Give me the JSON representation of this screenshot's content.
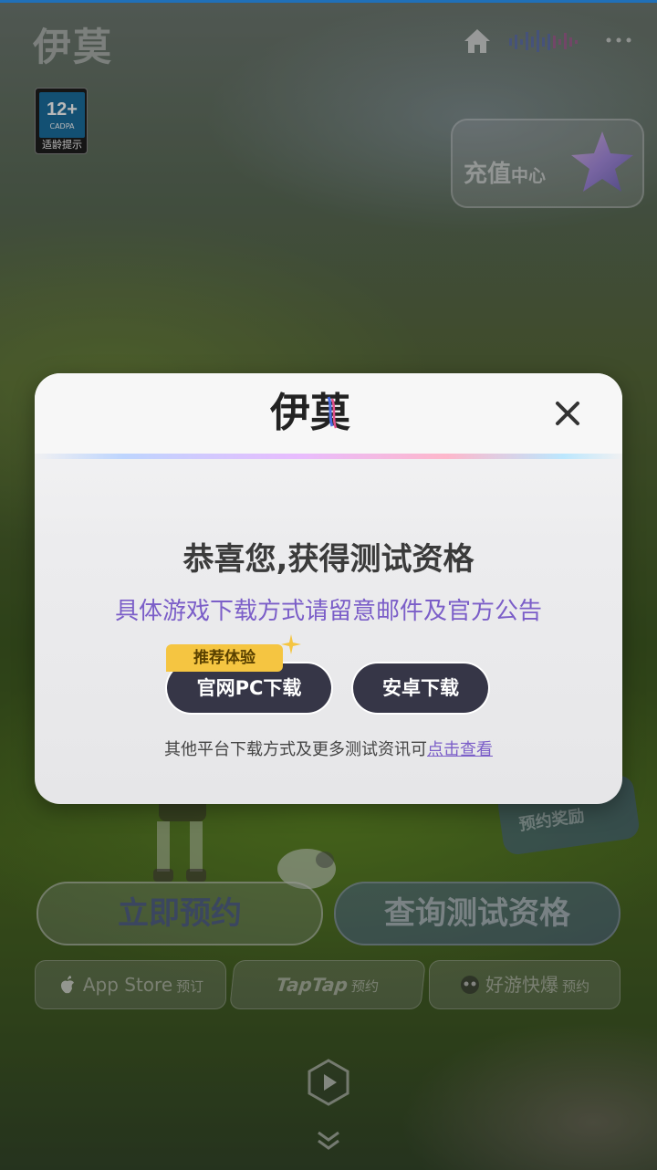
{
  "app": {
    "logo_text": "伊莫"
  },
  "header": {
    "icons": [
      "home-icon",
      "audio-wave-icon",
      "more-icon"
    ]
  },
  "age_rating": {
    "rating": "12+",
    "org": "CADPA",
    "hint": "适龄提示"
  },
  "recharge": {
    "label": "充值",
    "sub": "中心"
  },
  "modal": {
    "logo_text": "伊莫",
    "title": "恭喜您,获得测试资格",
    "subtitle": "具体游戏下载方式请留意邮件及官方公告",
    "recommend_badge": "推荐体验",
    "pc_download_label": "官网PC下载",
    "android_download_label": "安卓下载",
    "footer_text": "其他平台下载方式及更多测试资讯可",
    "footer_link": "点击查看"
  },
  "background_ui": {
    "reward_tag": "预约奖励",
    "reserve_label": "立即预约",
    "query_label": "查询测试资格",
    "stores": [
      {
        "name": "App Store",
        "action": "预订"
      },
      {
        "name": "TapTap",
        "action": "预约"
      },
      {
        "name": "好游快爆",
        "action": "预约"
      }
    ]
  },
  "colors": {
    "top_strip": "#2d9bff",
    "modal_bg": "#ececee",
    "button_dark": "#363647",
    "accent_purple": "#7b5ec8",
    "badge_yellow": "#f5c541"
  }
}
